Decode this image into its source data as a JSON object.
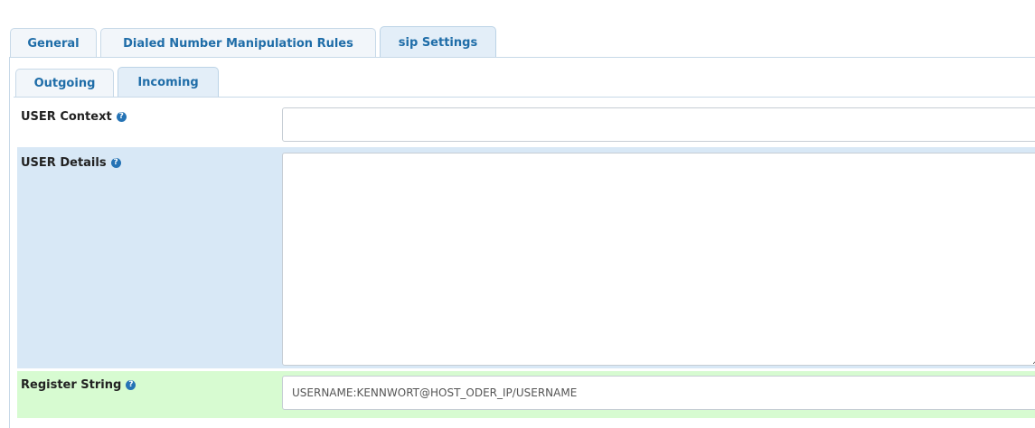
{
  "outer_tabs": [
    {
      "label": "General",
      "active": false
    },
    {
      "label": "Dialed Number Manipulation Rules",
      "active": false
    },
    {
      "label": "sip Settings",
      "active": true
    }
  ],
  "inner_tabs": [
    {
      "label": "Outgoing",
      "active": false
    },
    {
      "label": "Incoming",
      "active": true
    }
  ],
  "form": {
    "user_context": {
      "label": "USER Context",
      "value": ""
    },
    "user_details": {
      "label": "USER Details",
      "value": ""
    },
    "register_string": {
      "label": "Register String",
      "value": "USERNAME:KENNWORT@HOST_ODER_IP/USERNAME"
    }
  },
  "help_icon_glyph": "?",
  "colors": {
    "tab_text": "#1f6da8",
    "details_row_bg": "#d8e8f6",
    "register_row_bg": "#d7fbd1",
    "help_icon": "#2573b5"
  }
}
